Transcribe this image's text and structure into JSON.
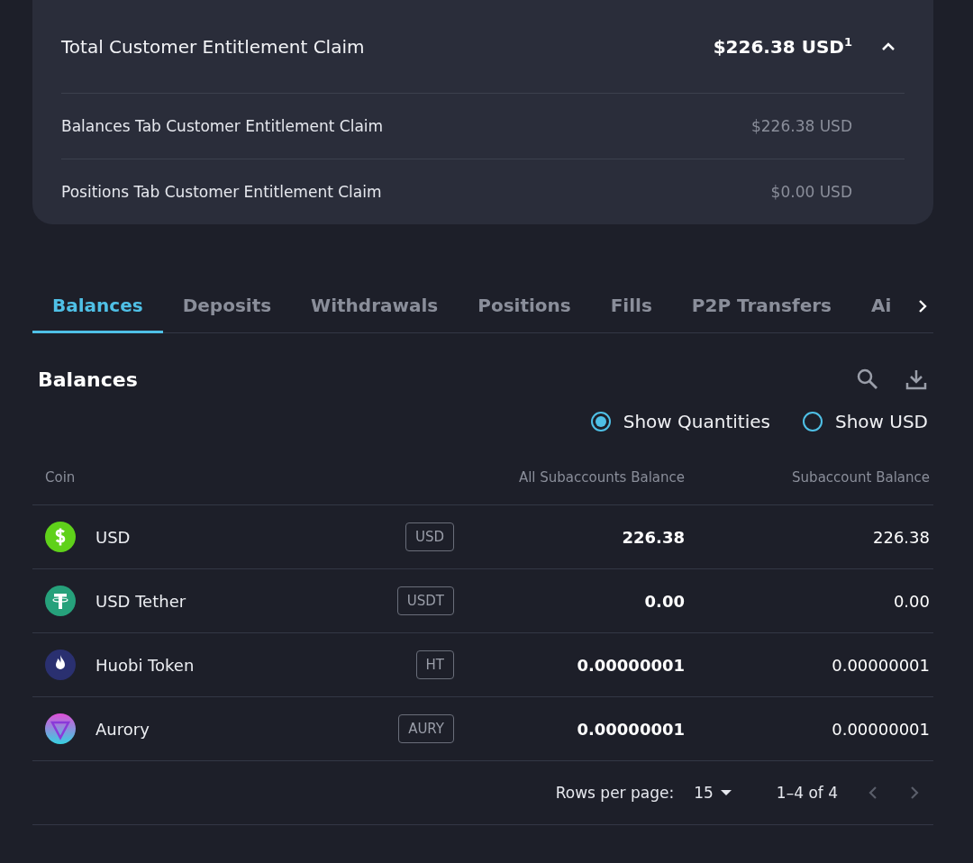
{
  "summary": {
    "title": "Total Customer Entitlement Claim",
    "total": "$226.38 USD$^{1}$",
    "expanded": true,
    "rows": [
      {
        "label": "Balances Tab Customer Entitlement Claim",
        "value": "$226.38 USD"
      },
      {
        "label": "Positions Tab Customer Entitlement Claim",
        "value": "$0.00 USD"
      }
    ]
  },
  "tabs": [
    {
      "label": "Balances",
      "selected": true
    },
    {
      "label": "Deposits",
      "selected": false
    },
    {
      "label": "Withdrawals",
      "selected": false
    },
    {
      "label": "Positions",
      "selected": false
    },
    {
      "label": "Fills",
      "selected": false
    },
    {
      "label": "P2P Transfers",
      "selected": false
    },
    {
      "label": "Ai",
      "selected": false
    }
  ],
  "section": {
    "title": "Balances"
  },
  "display_options": [
    {
      "label": "Show Quantities",
      "selected": true
    },
    {
      "label": "Show USD",
      "selected": false
    }
  ],
  "table": {
    "columns": [
      "Coin",
      "All Subaccounts Balance",
      "Subaccount Balance"
    ],
    "rows": [
      {
        "kind": "usd",
        "name": "USD",
        "symbol": "USD",
        "all_balance": "226.38",
        "balance": "226.38"
      },
      {
        "kind": "usdt",
        "name": "USD Tether",
        "symbol": "USDT",
        "all_balance": "0.00",
        "balance": "0.00"
      },
      {
        "kind": "ht",
        "name": "Huobi Token",
        "symbol": "HT",
        "all_balance": "0.00000001",
        "balance": "0.00000001"
      },
      {
        "kind": "aury",
        "name": "Aurory",
        "symbol": "AURY",
        "all_balance": "0.00000001",
        "balance": "0.00000001"
      }
    ]
  },
  "pagination": {
    "label": "Rows per page:",
    "rows_per_page": "15",
    "range": "1–4 of 4"
  }
}
